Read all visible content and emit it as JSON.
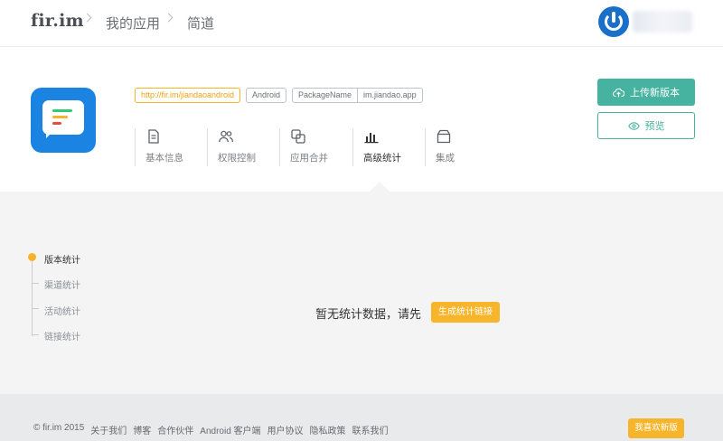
{
  "header": {
    "logo": "fir.im",
    "breadcrumb": [
      "我的应用",
      "简道"
    ]
  },
  "app": {
    "url": "http://fir.im/jiandaoandroid",
    "platform": "Android",
    "package_label": "PackageName",
    "package_name": "im.jiandao.app",
    "tabs": [
      {
        "label": "基本信息",
        "icon": "document-icon"
      },
      {
        "label": "权限控制",
        "icon": "users-icon"
      },
      {
        "label": "应用合并",
        "icon": "merge-icon"
      },
      {
        "label": "高级统计",
        "icon": "bar-chart-icon",
        "active": true
      },
      {
        "label": "集成",
        "icon": "box-icon"
      }
    ],
    "upload_label": "上传新版本",
    "preview_label": "预览"
  },
  "stats_nav": {
    "items": [
      "版本统计",
      "渠道统计",
      "活动统计",
      "链接统计"
    ],
    "active_index": 0
  },
  "empty_state": {
    "message": "暂无统计数据，请先",
    "button_label": "生成统计链接"
  },
  "footer": {
    "links": [
      "© fir.im 2015",
      "关于我们",
      "博客",
      "合作伙伴",
      "Android 客户端",
      "用户协议",
      "隐私政策",
      "联系我们"
    ],
    "new_version_label": "我喜欢新版"
  },
  "colors": {
    "accent_green": "#46b2a0",
    "accent_yellow": "#f7b52c",
    "app_icon_blue": "#1b84e3"
  }
}
